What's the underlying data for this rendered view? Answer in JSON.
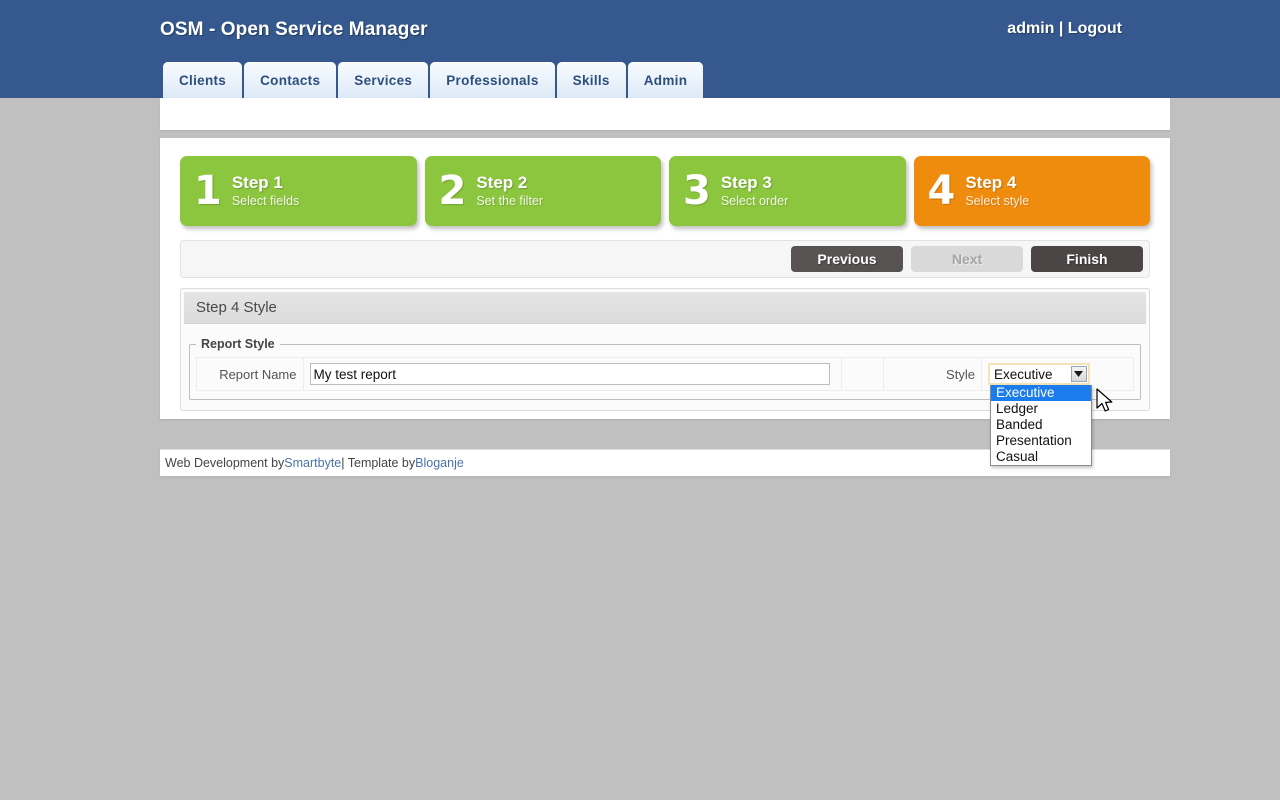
{
  "header": {
    "title": "OSM - Open Service Manager",
    "user": "admin",
    "separator": " | ",
    "logout": "Logout",
    "bg_color": "#35598f"
  },
  "nav": {
    "tabs": [
      {
        "label": "Clients"
      },
      {
        "label": "Contacts"
      },
      {
        "label": "Services"
      },
      {
        "label": "Professionals"
      },
      {
        "label": "Skills"
      },
      {
        "label": "Admin"
      }
    ]
  },
  "wizard": {
    "steps": [
      {
        "number": "1",
        "title": "Step 1",
        "subtitle": "Select fields",
        "state": "done",
        "color": "#8cc63e"
      },
      {
        "number": "2",
        "title": "Step 2",
        "subtitle": "Set the filter",
        "state": "done",
        "color": "#8cc63e"
      },
      {
        "number": "3",
        "title": "Step 3",
        "subtitle": "Select order",
        "state": "done",
        "color": "#8cc63e"
      },
      {
        "number": "4",
        "title": "Step 4",
        "subtitle": "Select style",
        "state": "active",
        "color": "#ef8c0d"
      }
    ],
    "buttons": {
      "previous": "Previous",
      "next": "Next",
      "next_disabled": true,
      "finish": "Finish"
    }
  },
  "content": {
    "heading": "Step 4 Style",
    "fieldset_legend": "Report Style",
    "report_name": {
      "label": "Report Name",
      "value": "My test report",
      "placeholder": ""
    },
    "style": {
      "label": "Style",
      "selected": "Executive",
      "open": true,
      "options": [
        "Executive",
        "Ledger",
        "Banded",
        "Presentation",
        "Casual"
      ],
      "highlight_color": "#1b7ced"
    }
  },
  "footer": {
    "prefix": "Web Development by ",
    "link1": "Smartbyte",
    "middle": " | Template by ",
    "link2": "Bloganje"
  }
}
